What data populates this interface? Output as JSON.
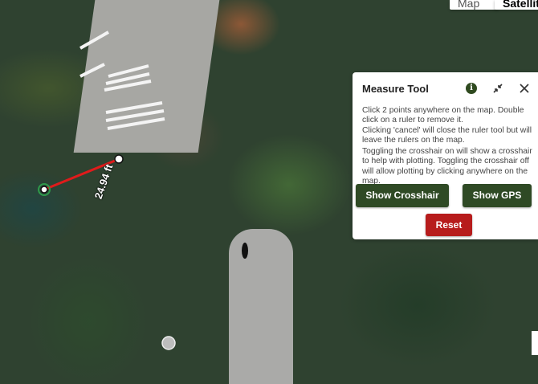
{
  "map": {
    "map_type_buttons": [
      {
        "label": "Map",
        "active": false
      },
      {
        "label": "Satellite",
        "active": true
      }
    ],
    "ruler": {
      "distance_label": "24.94 ft",
      "line_color": "#e01b1b"
    }
  },
  "measure_tool": {
    "title": "Measure Tool",
    "instructions": [
      "Click 2 points anywhere on the map. Double click on a ruler to remove it.",
      "Clicking 'cancel' will close the ruler tool but will leave the rulers on the map.",
      "Toggling the crosshair on will show a crosshair to help with plotting. Toggling the crosshair off will allow plotting by clicking anywhere on the map."
    ],
    "buttons": {
      "show_crosshair": "Show Crosshair",
      "show_gps": "Show GPS",
      "reset": "Reset"
    },
    "colors": {
      "primary_button": "#2f4a25",
      "reset_button": "#b71c1c"
    }
  }
}
